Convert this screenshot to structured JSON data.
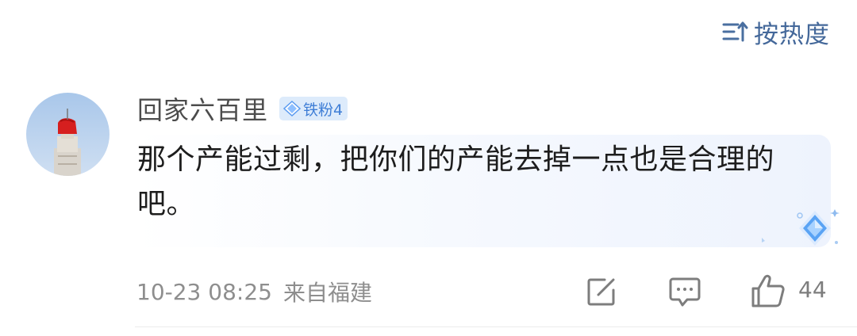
{
  "sort": {
    "label": "按热度",
    "icon": "sort-icon"
  },
  "comment": {
    "username": "回家六百里",
    "badge_label": "铁粉4",
    "badge_icon": "diamond-icon",
    "text": "那个产能过剩，把你们的产能去掉一点也是合理的吧。",
    "timestamp": "10-23 08:25",
    "location": "来自福建",
    "like_count": "44",
    "actions": [
      "share-icon",
      "reply-icon",
      "like-icon"
    ]
  },
  "colors": {
    "accent": "#44689a",
    "badge_bg": "#ddebfb",
    "badge_text": "#3f7ed6",
    "meta_text": "#8e8e8e"
  }
}
